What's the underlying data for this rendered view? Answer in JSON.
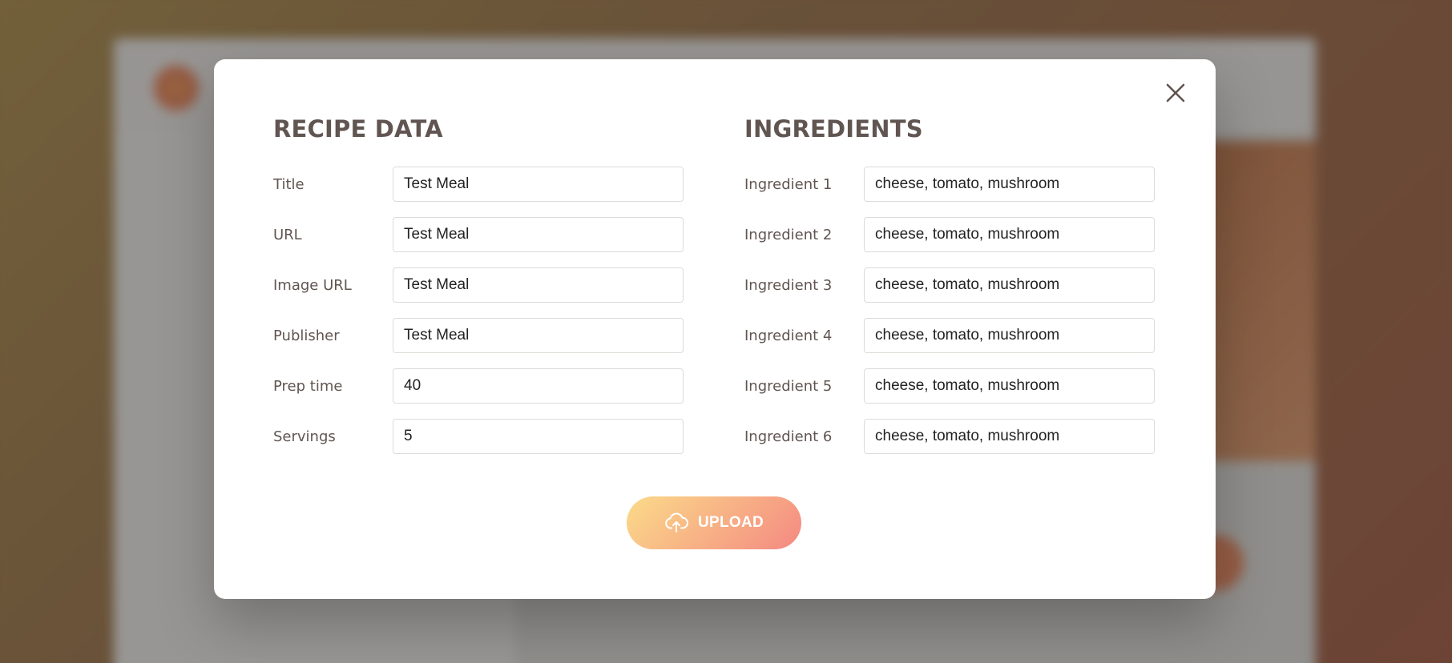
{
  "modal": {
    "close_icon": "close-icon",
    "recipe_data": {
      "heading": "RECIPE DATA",
      "fields": [
        {
          "label": "Title",
          "value": "Test Meal"
        },
        {
          "label": "URL",
          "value": "Test Meal"
        },
        {
          "label": "Image URL",
          "value": "Test Meal"
        },
        {
          "label": "Publisher",
          "value": "Test Meal"
        },
        {
          "label": "Prep time",
          "value": "40"
        },
        {
          "label": "Servings",
          "value": "5"
        }
      ]
    },
    "ingredients": {
      "heading": "INGREDIENTS",
      "fields": [
        {
          "label": "Ingredient 1",
          "value": "cheese, tomato, mushroom"
        },
        {
          "label": "Ingredient 2",
          "value": "cheese, tomato, mushroom"
        },
        {
          "label": "Ingredient 3",
          "value": "cheese, tomato, mushroom"
        },
        {
          "label": "Ingredient 4",
          "value": "cheese, tomato, mushroom"
        },
        {
          "label": "Ingredient 5",
          "value": "cheese, tomato, mushroom"
        },
        {
          "label": "Ingredient 6",
          "value": "cheese, tomato, mushroom"
        }
      ]
    },
    "upload_button": {
      "label": "UPLOAD",
      "icon": "cloud-upload-icon"
    }
  },
  "colors": {
    "accent_gradient_start": "#fbdb89",
    "accent_gradient_end": "#f48982",
    "heading_text": "#615551",
    "overlay": "rgba(0,0,0,0.38)"
  }
}
